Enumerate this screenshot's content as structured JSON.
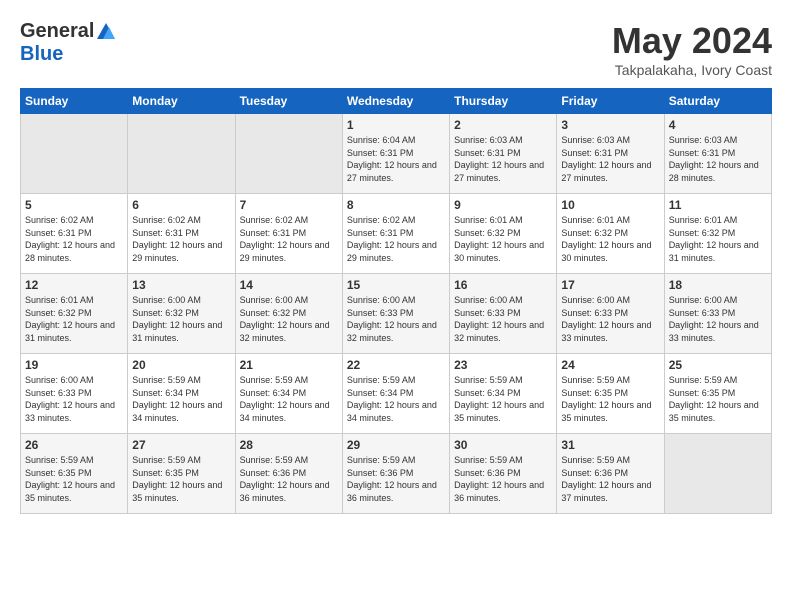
{
  "header": {
    "logo_general": "General",
    "logo_blue": "Blue",
    "month": "May 2024",
    "location": "Takpalakaha, Ivory Coast"
  },
  "weekdays": [
    "Sunday",
    "Monday",
    "Tuesday",
    "Wednesday",
    "Thursday",
    "Friday",
    "Saturday"
  ],
  "weeks": [
    [
      {
        "day": "",
        "sunrise": "",
        "sunset": "",
        "daylight": "",
        "empty": true
      },
      {
        "day": "",
        "sunrise": "",
        "sunset": "",
        "daylight": "",
        "empty": true
      },
      {
        "day": "",
        "sunrise": "",
        "sunset": "",
        "daylight": "",
        "empty": true
      },
      {
        "day": "1",
        "sunrise": "Sunrise: 6:04 AM",
        "sunset": "Sunset: 6:31 PM",
        "daylight": "Daylight: 12 hours and 27 minutes.",
        "empty": false
      },
      {
        "day": "2",
        "sunrise": "Sunrise: 6:03 AM",
        "sunset": "Sunset: 6:31 PM",
        "daylight": "Daylight: 12 hours and 27 minutes.",
        "empty": false
      },
      {
        "day": "3",
        "sunrise": "Sunrise: 6:03 AM",
        "sunset": "Sunset: 6:31 PM",
        "daylight": "Daylight: 12 hours and 27 minutes.",
        "empty": false
      },
      {
        "day": "4",
        "sunrise": "Sunrise: 6:03 AM",
        "sunset": "Sunset: 6:31 PM",
        "daylight": "Daylight: 12 hours and 28 minutes.",
        "empty": false
      }
    ],
    [
      {
        "day": "5",
        "sunrise": "Sunrise: 6:02 AM",
        "sunset": "Sunset: 6:31 PM",
        "daylight": "Daylight: 12 hours and 28 minutes.",
        "empty": false
      },
      {
        "day": "6",
        "sunrise": "Sunrise: 6:02 AM",
        "sunset": "Sunset: 6:31 PM",
        "daylight": "Daylight: 12 hours and 29 minutes.",
        "empty": false
      },
      {
        "day": "7",
        "sunrise": "Sunrise: 6:02 AM",
        "sunset": "Sunset: 6:31 PM",
        "daylight": "Daylight: 12 hours and 29 minutes.",
        "empty": false
      },
      {
        "day": "8",
        "sunrise": "Sunrise: 6:02 AM",
        "sunset": "Sunset: 6:31 PM",
        "daylight": "Daylight: 12 hours and 29 minutes.",
        "empty": false
      },
      {
        "day": "9",
        "sunrise": "Sunrise: 6:01 AM",
        "sunset": "Sunset: 6:32 PM",
        "daylight": "Daylight: 12 hours and 30 minutes.",
        "empty": false
      },
      {
        "day": "10",
        "sunrise": "Sunrise: 6:01 AM",
        "sunset": "Sunset: 6:32 PM",
        "daylight": "Daylight: 12 hours and 30 minutes.",
        "empty": false
      },
      {
        "day": "11",
        "sunrise": "Sunrise: 6:01 AM",
        "sunset": "Sunset: 6:32 PM",
        "daylight": "Daylight: 12 hours and 31 minutes.",
        "empty": false
      }
    ],
    [
      {
        "day": "12",
        "sunrise": "Sunrise: 6:01 AM",
        "sunset": "Sunset: 6:32 PM",
        "daylight": "Daylight: 12 hours and 31 minutes.",
        "empty": false
      },
      {
        "day": "13",
        "sunrise": "Sunrise: 6:00 AM",
        "sunset": "Sunset: 6:32 PM",
        "daylight": "Daylight: 12 hours and 31 minutes.",
        "empty": false
      },
      {
        "day": "14",
        "sunrise": "Sunrise: 6:00 AM",
        "sunset": "Sunset: 6:32 PM",
        "daylight": "Daylight: 12 hours and 32 minutes.",
        "empty": false
      },
      {
        "day": "15",
        "sunrise": "Sunrise: 6:00 AM",
        "sunset": "Sunset: 6:33 PM",
        "daylight": "Daylight: 12 hours and 32 minutes.",
        "empty": false
      },
      {
        "day": "16",
        "sunrise": "Sunrise: 6:00 AM",
        "sunset": "Sunset: 6:33 PM",
        "daylight": "Daylight: 12 hours and 32 minutes.",
        "empty": false
      },
      {
        "day": "17",
        "sunrise": "Sunrise: 6:00 AM",
        "sunset": "Sunset: 6:33 PM",
        "daylight": "Daylight: 12 hours and 33 minutes.",
        "empty": false
      },
      {
        "day": "18",
        "sunrise": "Sunrise: 6:00 AM",
        "sunset": "Sunset: 6:33 PM",
        "daylight": "Daylight: 12 hours and 33 minutes.",
        "empty": false
      }
    ],
    [
      {
        "day": "19",
        "sunrise": "Sunrise: 6:00 AM",
        "sunset": "Sunset: 6:33 PM",
        "daylight": "Daylight: 12 hours and 33 minutes.",
        "empty": false
      },
      {
        "day": "20",
        "sunrise": "Sunrise: 5:59 AM",
        "sunset": "Sunset: 6:34 PM",
        "daylight": "Daylight: 12 hours and 34 minutes.",
        "empty": false
      },
      {
        "day": "21",
        "sunrise": "Sunrise: 5:59 AM",
        "sunset": "Sunset: 6:34 PM",
        "daylight": "Daylight: 12 hours and 34 minutes.",
        "empty": false
      },
      {
        "day": "22",
        "sunrise": "Sunrise: 5:59 AM",
        "sunset": "Sunset: 6:34 PM",
        "daylight": "Daylight: 12 hours and 34 minutes.",
        "empty": false
      },
      {
        "day": "23",
        "sunrise": "Sunrise: 5:59 AM",
        "sunset": "Sunset: 6:34 PM",
        "daylight": "Daylight: 12 hours and 35 minutes.",
        "empty": false
      },
      {
        "day": "24",
        "sunrise": "Sunrise: 5:59 AM",
        "sunset": "Sunset: 6:35 PM",
        "daylight": "Daylight: 12 hours and 35 minutes.",
        "empty": false
      },
      {
        "day": "25",
        "sunrise": "Sunrise: 5:59 AM",
        "sunset": "Sunset: 6:35 PM",
        "daylight": "Daylight: 12 hours and 35 minutes.",
        "empty": false
      }
    ],
    [
      {
        "day": "26",
        "sunrise": "Sunrise: 5:59 AM",
        "sunset": "Sunset: 6:35 PM",
        "daylight": "Daylight: 12 hours and 35 minutes.",
        "empty": false
      },
      {
        "day": "27",
        "sunrise": "Sunrise: 5:59 AM",
        "sunset": "Sunset: 6:35 PM",
        "daylight": "Daylight: 12 hours and 35 minutes.",
        "empty": false
      },
      {
        "day": "28",
        "sunrise": "Sunrise: 5:59 AM",
        "sunset": "Sunset: 6:36 PM",
        "daylight": "Daylight: 12 hours and 36 minutes.",
        "empty": false
      },
      {
        "day": "29",
        "sunrise": "Sunrise: 5:59 AM",
        "sunset": "Sunset: 6:36 PM",
        "daylight": "Daylight: 12 hours and 36 minutes.",
        "empty": false
      },
      {
        "day": "30",
        "sunrise": "Sunrise: 5:59 AM",
        "sunset": "Sunset: 6:36 PM",
        "daylight": "Daylight: 12 hours and 36 minutes.",
        "empty": false
      },
      {
        "day": "31",
        "sunrise": "Sunrise: 5:59 AM",
        "sunset": "Sunset: 6:36 PM",
        "daylight": "Daylight: 12 hours and 37 minutes.",
        "empty": false
      },
      {
        "day": "",
        "sunrise": "",
        "sunset": "",
        "daylight": "",
        "empty": true
      }
    ]
  ]
}
